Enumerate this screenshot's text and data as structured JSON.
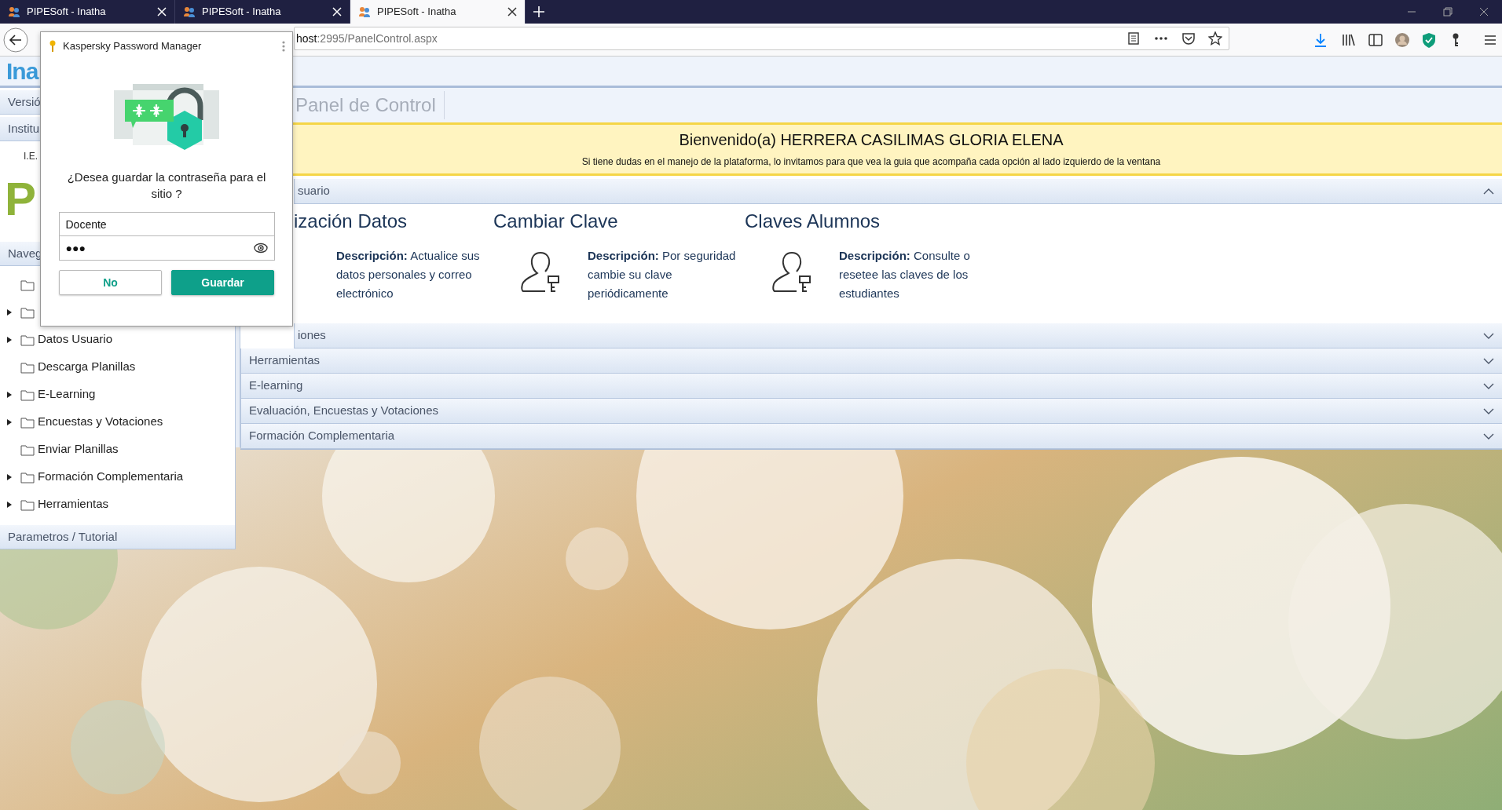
{
  "browser": {
    "tabs": [
      {
        "title": "PIPESoft - Inatha",
        "selected": false
      },
      {
        "title": "PIPESoft - Inatha",
        "selected": false
      },
      {
        "title": "PIPESoft - Inatha",
        "selected": true
      }
    ],
    "address": {
      "host": "host",
      "path": ":2995/PanelControl.aspx"
    }
  },
  "password_popup": {
    "title": "Kaspersky Password Manager",
    "question": "¿Desea guardar la contraseña para el sitio ?",
    "username": "Docente",
    "password": "●●●",
    "buttons": [
      {
        "label": "No",
        "kind": "secondary"
      },
      {
        "label": "Guardar",
        "kind": "primary"
      }
    ]
  },
  "header": {
    "logo": "Ina"
  },
  "sidebar": {
    "sections": [
      "Versió",
      "Institu"
    ],
    "institution": "I.E.",
    "logo_letter": "P",
    "nav_title": "Naveg",
    "tree": [
      {
        "expandable": false
      },
      {
        "expandable": true
      },
      {
        "label": "Datos Usuario",
        "expandable": true
      },
      {
        "label": "Descarga Planillas",
        "expandable": false
      },
      {
        "label": "E-Learning",
        "expandable": true
      },
      {
        "label": "Encuestas y Votaciones",
        "expandable": true
      },
      {
        "label": "Enviar Planillas",
        "expandable": false
      },
      {
        "label": "Formación Complementaria",
        "expandable": true
      },
      {
        "label": "Herramientas",
        "expandable": true
      }
    ],
    "footer": "Parametros / Tutorial"
  },
  "main": {
    "title": "Panel de Control",
    "welcome": {
      "title": "Bienvenido(a) HERRERA CASILIMAS GLORIA ELENA",
      "text": "Si tiene dudas en el manejo de la plataforma, lo invitamos para que vea la guia que acompaña cada opción al lado izquierdo de la ventana"
    },
    "panels": [
      {
        "title": "suario",
        "expanded": true,
        "cards": [
          {
            "title": "ización Datos",
            "show_icon": false,
            "description": "**Descripción:** Actualice sus datos personales y correo electrónico"
          },
          {
            "title": "Cambiar Clave",
            "show_icon": true,
            "description": "**Descripción:** Por seguridad cambie su clave periódicamente"
          },
          {
            "title": "Claves Alumnos",
            "show_icon": true,
            "description": "**Descripción:** Consulte o resetee las claves de los estudiantes"
          }
        ]
      },
      {
        "title": "iones",
        "expanded": false
      },
      {
        "title": "Herramientas",
        "expanded": false
      },
      {
        "title": "E-learning",
        "expanded": false
      },
      {
        "title": "Evaluación, Encuestas y Votaciones",
        "expanded": false
      },
      {
        "title": "Formación Complementaria",
        "expanded": false
      }
    ]
  }
}
